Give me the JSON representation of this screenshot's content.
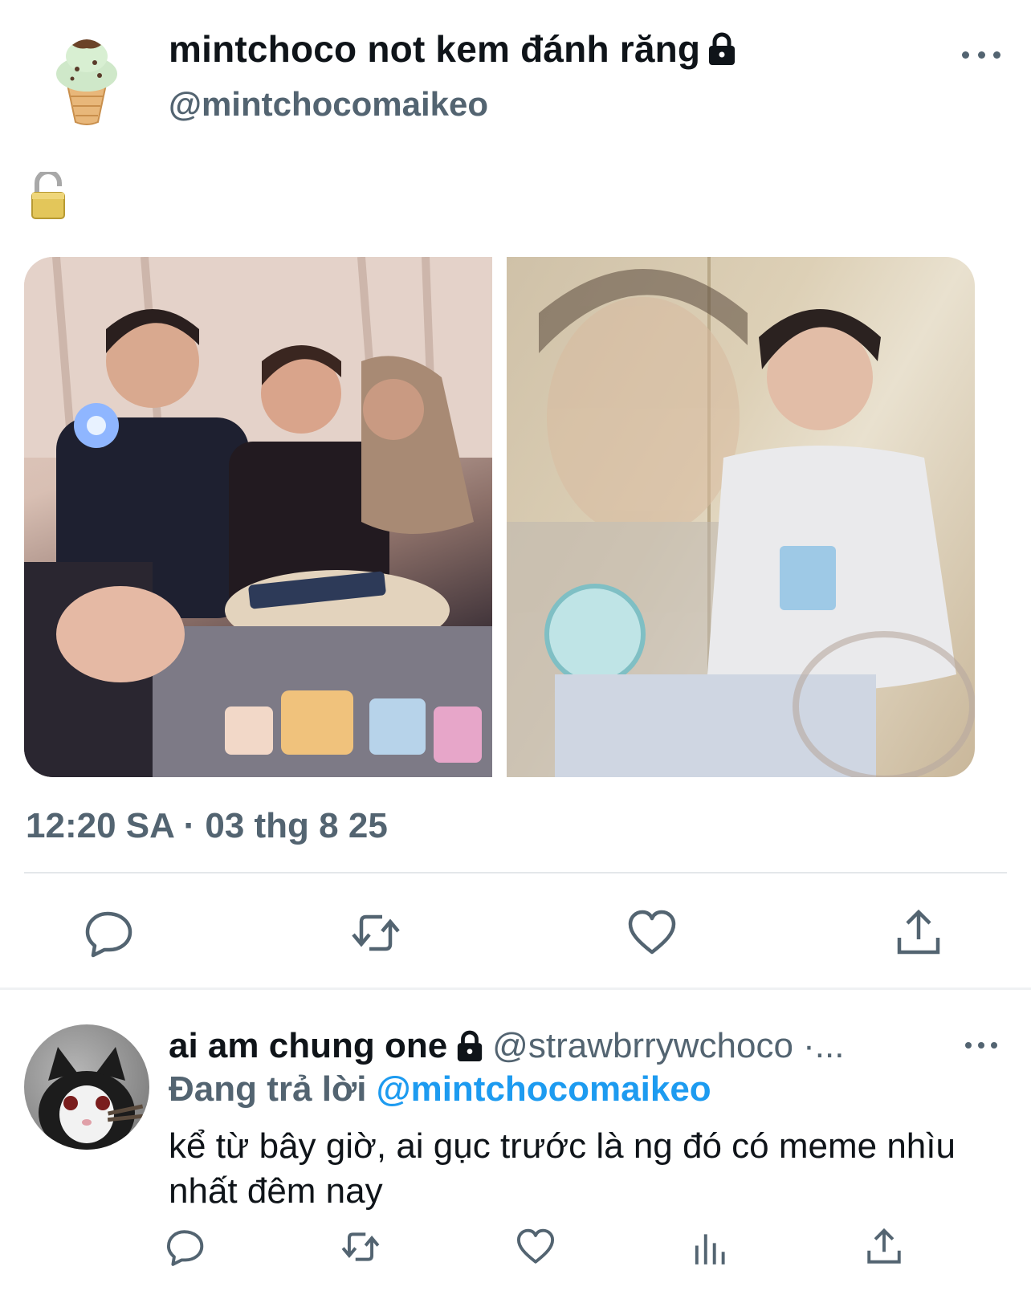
{
  "tweet": {
    "display_name": "mintchoco not kem đánh răng",
    "handle": "@mintchocomaikeo",
    "body_emoji": "open-padlock-emoji",
    "timestamp": "12:20 SA · 03 thg 8 25",
    "actions": [
      "reply-icon",
      "retweet-icon",
      "like-icon",
      "share-icon"
    ]
  },
  "reply": {
    "display_name": "ai am chung one",
    "handle": "@strawbrrywchoco ·...",
    "replying_label": "Đang trả lời",
    "replying_to": "@mintchocomaikeo",
    "text": "kể từ bây giờ, ai gục trước là ng đó có meme nhìu nhất đêm nay",
    "actions": [
      "reply-icon",
      "retweet-icon",
      "like-icon",
      "views-icon",
      "share-icon"
    ]
  },
  "colors": {
    "text": "#0f1419",
    "secondary": "#536471",
    "link": "#1d9bf0"
  }
}
